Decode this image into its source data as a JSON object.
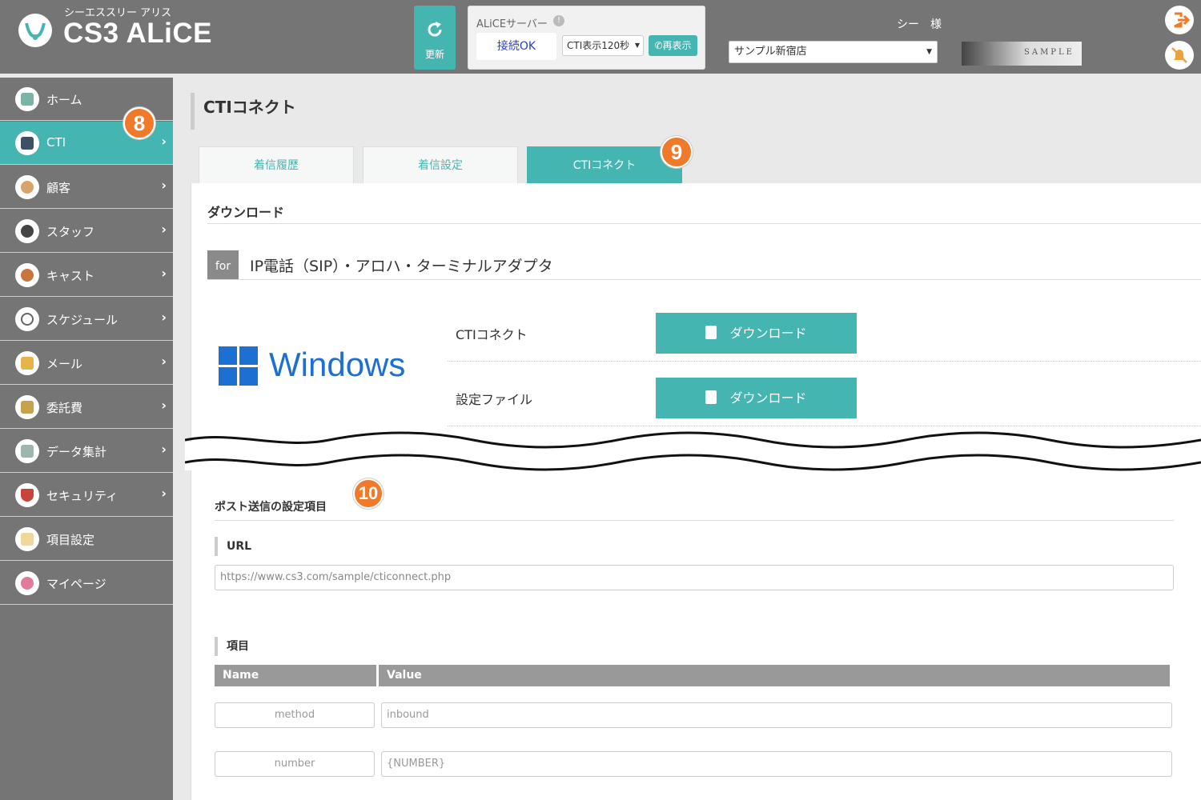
{
  "header": {
    "logo_sub": "シーエススリー アリス",
    "logo_main": "CS3 ALiCE",
    "refresh_label": "更新",
    "server_title": "ALiCEサーバー",
    "server_status": "接続OK",
    "cti_display": "CTI表示120秒",
    "redisplay_label": "再表示",
    "user_name": "シー　様",
    "shop_select": "サンプル新宿店",
    "banner_text": "SAMPLE"
  },
  "sidebar": {
    "items": [
      {
        "label": "ホーム"
      },
      {
        "label": "CTI"
      },
      {
        "label": "顧客"
      },
      {
        "label": "スタッフ"
      },
      {
        "label": "キャスト"
      },
      {
        "label": "スケジュール"
      },
      {
        "label": "メール"
      },
      {
        "label": "委託費"
      },
      {
        "label": "データ集計"
      },
      {
        "label": "セキュリティ"
      },
      {
        "label": "項目設定"
      },
      {
        "label": "マイページ"
      }
    ]
  },
  "badges": {
    "b8": "8",
    "b9": "9",
    "b10": "10"
  },
  "main": {
    "title": "CTIコネクト",
    "tabs": [
      {
        "label": "着信履歴"
      },
      {
        "label": "着信設定"
      },
      {
        "label": "CTIコネクト"
      }
    ],
    "download_heading": "ダウンロード",
    "for_tag": "for",
    "for_text": "IP電話（SIP）・アロハ・ターミナルアダプタ",
    "os_label": "Windows",
    "downloads": [
      {
        "label": "CTIコネクト",
        "button": "ダウンロード"
      },
      {
        "label": "設定ファイル",
        "button": "ダウンロード"
      }
    ],
    "post_heading": "ポスト送信の設定項目",
    "url_label": "URL",
    "url_value": "https://www.cs3.com/sample/cticonnect.php",
    "items_label": "項目",
    "table_headers": {
      "name": "Name",
      "value": "Value"
    },
    "rows": [
      {
        "name": "method",
        "value": "inbound"
      },
      {
        "name": "number",
        "value": "{NUMBER}"
      }
    ]
  },
  "colors": {
    "accent": "#45b5b2",
    "header_bg": "#757575",
    "badge": "#f07a2a",
    "windows_blue": "#1d6fd1"
  }
}
